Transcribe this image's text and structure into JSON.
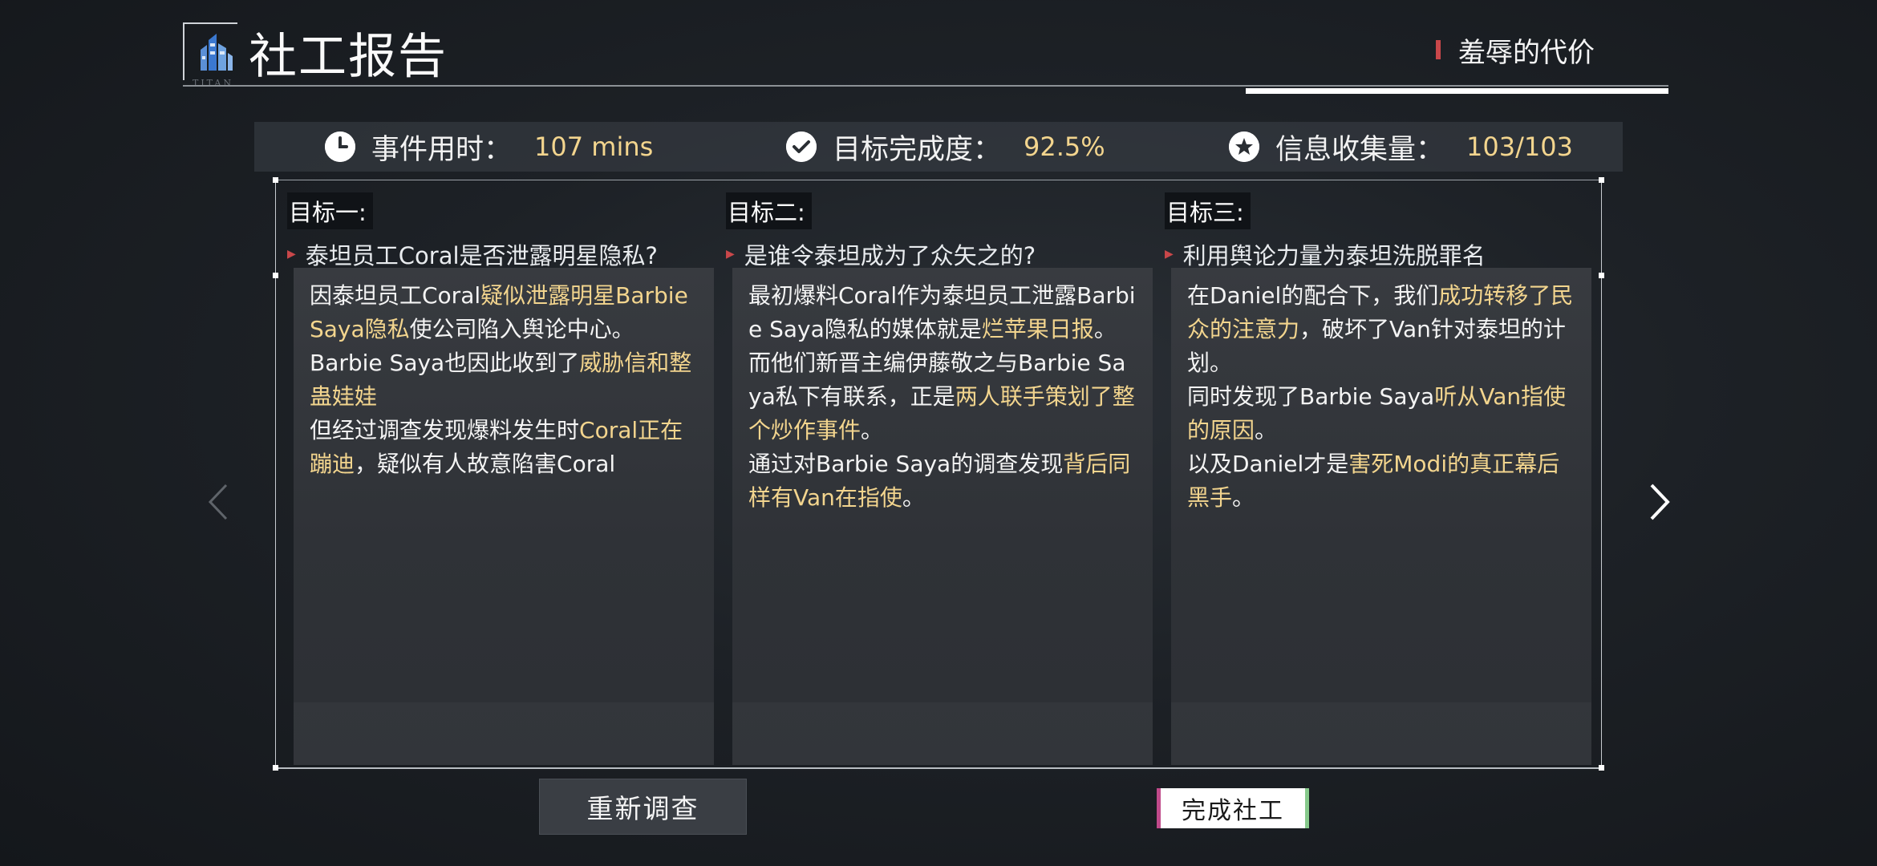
{
  "header": {
    "logo_text": "TITAN",
    "title": "社工报告",
    "chapter": "羞辱的代价"
  },
  "stats": {
    "time": {
      "label": "事件用时：",
      "value": "107 mins",
      "icon": "clock-icon"
    },
    "completion": {
      "label": "目标完成度：",
      "value": "92.5%",
      "icon": "check-circle-icon"
    },
    "info": {
      "label": "信息收集量：",
      "value": "103/103",
      "icon": "star-circle-icon"
    }
  },
  "goals": [
    {
      "label": "目标一:",
      "question": "泰坦员工Coral是否泄露明星隐私?",
      "text": [
        {
          "t": "因泰坦员工Coral",
          "hl": false
        },
        {
          "t": "疑似泄露明星Barbie Saya隐私",
          "hl": true
        },
        {
          "t": "使公司陷入舆论中心。",
          "hl": false
        },
        {
          "br": true
        },
        {
          "t": "Barbie Saya也因此收到了",
          "hl": false
        },
        {
          "t": "威胁信和整蛊娃娃",
          "hl": true
        },
        {
          "br": true
        },
        {
          "t": "但经过调查发现爆料发生时",
          "hl": false
        },
        {
          "t": "Coral正在蹦迪",
          "hl": true
        },
        {
          "t": "，疑似有人故意陷害Coral",
          "hl": false
        }
      ]
    },
    {
      "label": "目标二:",
      "question": "是谁令泰坦成为了众矢之的?",
      "text": [
        {
          "t": "最初爆料Coral作为泰坦员工泄露Barbie Saya隐私的媒体就是",
          "hl": false
        },
        {
          "t": "烂苹果日报",
          "hl": true
        },
        {
          "t": "。",
          "hl": false
        },
        {
          "br": true
        },
        {
          "t": "而他们新晋主编伊藤敬之与Barbie Saya私下有联系，正是",
          "hl": false
        },
        {
          "t": "两人联手策划了整个炒作事件",
          "hl": true
        },
        {
          "t": "。",
          "hl": false
        },
        {
          "br": true
        },
        {
          "t": "通过对Barbie Saya的调查发现",
          "hl": false
        },
        {
          "t": "背后同样有Van在指使",
          "hl": true
        },
        {
          "t": "。",
          "hl": false
        }
      ]
    },
    {
      "label": "目标三:",
      "question": "利用舆论力量为泰坦洗脱罪名",
      "text": [
        {
          "t": "在Daniel的配合下，我们",
          "hl": false
        },
        {
          "t": "成功转移了民众的注意力",
          "hl": true
        },
        {
          "t": "，破坏了Van针对泰坦的计划。",
          "hl": false
        },
        {
          "br": true
        },
        {
          "t": "同时发现了Barbie Saya",
          "hl": false
        },
        {
          "t": "听从Van指使的原因",
          "hl": true
        },
        {
          "t": "。",
          "hl": false
        },
        {
          "br": true
        },
        {
          "t": "以及Daniel才是",
          "hl": false
        },
        {
          "t": "害死Modi的真正幕后黑手",
          "hl": true
        },
        {
          "t": "。",
          "hl": false
        }
      ]
    }
  ],
  "buttons": {
    "reinvestigate": "重新调查",
    "complete": "完成社工"
  },
  "nav": {
    "prev_icon": "chevron-left-icon",
    "next_icon": "chevron-right-icon"
  },
  "colors": {
    "highlight": "#f3d58e",
    "accent_red": "#c9474a",
    "background": "#1d2126"
  }
}
